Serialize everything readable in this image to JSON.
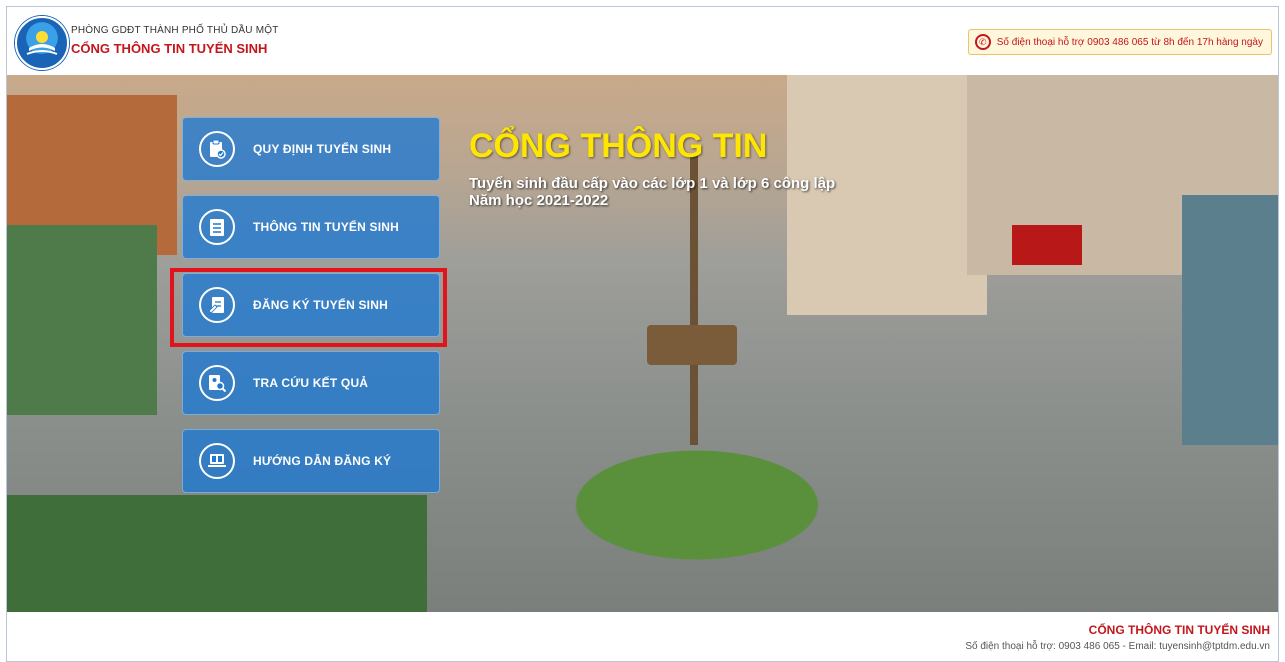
{
  "header": {
    "org_name": "PHÒNG GDĐT THÀNH PHỐ THỦ DẦU MỘT",
    "portal_name": "CỔNG THÔNG TIN TUYỂN SINH",
    "hotline": "Số điện thoại hỗ trợ 0903 486 065 từ 8h đến 17h hàng ngày"
  },
  "hero": {
    "title": "CỔNG THÔNG TIN",
    "subtitle_line1": "Tuyển sinh đầu cấp vào các lớp 1 và lớp 6 công lập",
    "subtitle_line2": "Năm học 2021-2022"
  },
  "menu": [
    {
      "label": "QUY ĐỊNH TUYỂN SINH",
      "icon": "clipboard-check-icon"
    },
    {
      "label": "THÔNG TIN TUYỂN SINH",
      "icon": "notepad-icon"
    },
    {
      "label": "ĐĂNG KÝ TUYỂN SINH",
      "icon": "edit-form-icon"
    },
    {
      "label": "TRA CỨU KẾT QUẢ",
      "icon": "search-profile-icon"
    },
    {
      "label": "HƯỚNG DẪN ĐĂNG KÝ",
      "icon": "laptop-guide-icon"
    }
  ],
  "highlight_color": "#e0141a",
  "footer": {
    "title": "CỔNG THÔNG TIN TUYỂN SINH",
    "contact": "Số điện thoại hỗ trợ: 0903 486 065 - Email: tuyensinh@tptdm.edu.vn"
  }
}
